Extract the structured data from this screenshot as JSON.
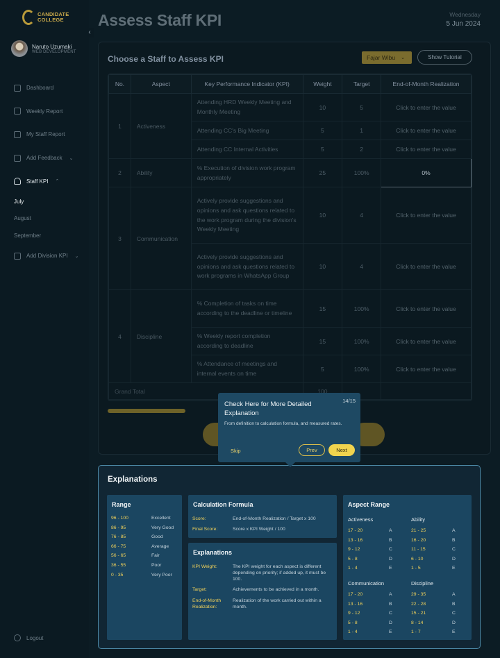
{
  "sidebar": {
    "logo_text_1": "CANDIDATE",
    "logo_text_2": "COLLEGE",
    "user_name": "Naruto Uzumaki",
    "user_role": "WEB DEVELOPMENT",
    "items": [
      {
        "label": "Dashboard"
      },
      {
        "label": "Weekly Report"
      },
      {
        "label": "My Staff Report"
      },
      {
        "label": "Add Feedback"
      },
      {
        "label": "Staff KPI"
      }
    ],
    "sub_items": [
      {
        "label": "July"
      },
      {
        "label": "August"
      },
      {
        "label": "September"
      }
    ],
    "add_division": "Add Division KPI",
    "logout": "Logout"
  },
  "header": {
    "title": "Assess Staff KPI",
    "day": "Wednesday",
    "date": "5 Jun 2024"
  },
  "kpi": {
    "heading": "Choose a  Staff to Assess KPI",
    "staff_selected": "Fajar Wibu",
    "tutorial_label": "Show Tutorial",
    "columns": [
      "No.",
      "Aspect",
      "Key Performance Indicator (KPI)",
      "Weight",
      "Target",
      "End-of-Month Realization"
    ],
    "groups": [
      {
        "no": "1",
        "aspect": "Activeness",
        "rows": [
          {
            "kpi": "Attending HRD Weekly Meeting and Monthly Meeting",
            "weight": "10",
            "target": "5",
            "real": "Click to enter the value"
          },
          {
            "kpi": "Attending CC's Big Meeting",
            "weight": "5",
            "target": "1",
            "real": "Click to enter the value"
          },
          {
            "kpi": "Attending CC Internal Activities",
            "weight": "5",
            "target": "2",
            "real": "Click to enter the value"
          }
        ]
      },
      {
        "no": "2",
        "aspect": "Ability",
        "rows": [
          {
            "kpi": "% Execution of division work program appropriately",
            "weight": "25",
            "target": "100%",
            "real": "0%"
          }
        ]
      },
      {
        "no": "3",
        "aspect": "Communication",
        "rows": [
          {
            "kpi": "Actively provide suggestions and opinions and ask questions related to the work program during the division's Weekly Meeting",
            "weight": "10",
            "target": "4",
            "real": "Click to enter the value"
          },
          {
            "kpi": "Actively provide suggestions and opinions and ask questions related to work programs in WhatsApp Group",
            "weight": "10",
            "target": "4",
            "real": "Click to enter the value"
          }
        ]
      },
      {
        "no": "4",
        "aspect": "Discipline",
        "rows": [
          {
            "kpi": "% Completion of tasks on time according to the deadline or timeline",
            "weight": "15",
            "target": "100%",
            "real": "Click to enter the value"
          },
          {
            "kpi": "% Weekly report completion according to deadline",
            "weight": "15",
            "target": "100%",
            "real": "Click to enter the value"
          },
          {
            "kpi": "% Attendance of meetings and internal events on time",
            "weight": "5",
            "target": "100%",
            "real": "Click to enter the value"
          }
        ]
      }
    ],
    "grand_total_label": "Grand Total",
    "grand_total_value": "100"
  },
  "tooltip": {
    "step": "14/15",
    "title": "Check Here for More Detailed Explanation",
    "desc": "From definition to calculation formula, and measured rates.",
    "skip": "Skip",
    "prev": "Prev",
    "next": "Next"
  },
  "explanations": {
    "title": "Explanations",
    "range": {
      "title": "Range",
      "rows": [
        {
          "r": "96 - 100",
          "g": "Excellent"
        },
        {
          "r": "86 - 95",
          "g": "Very Good"
        },
        {
          "r": "76 - 85",
          "g": "Good"
        },
        {
          "r": "66 - 75",
          "g": "Average"
        },
        {
          "r": "56 - 65",
          "g": "Fair"
        },
        {
          "r": "36 - 55",
          "g": "Poor"
        },
        {
          "r": "0 - 35",
          "g": "Very Poor"
        }
      ]
    },
    "formula": {
      "title": "Calculation Formula",
      "rows": [
        {
          "k": "Score:",
          "v": "End-of-Month Realization / Target x 100"
        },
        {
          "k": "Final Score:",
          "v": "Score x KPI Weight / 100"
        }
      ]
    },
    "defs": {
      "title": "Explanations",
      "rows": [
        {
          "k": "KPI Weight:",
          "v": "The KPI weight for each aspect is different depending on priority; if added up, it must be 100."
        },
        {
          "k": "Target:",
          "v": "Achievements to be achieved in a month."
        },
        {
          "k": "End-of-Month Realization:",
          "v": "Realization of the work carried out within a month."
        }
      ]
    },
    "aspect_range": {
      "title": "Aspect Range",
      "groups": [
        {
          "name": "Activeness",
          "rows": [
            {
              "r": "17 - 20",
              "g": "A"
            },
            {
              "r": "13 - 16",
              "g": "B"
            },
            {
              "r": "9 - 12",
              "g": "C"
            },
            {
              "r": "5 - 8",
              "g": "D"
            },
            {
              "r": "1 - 4",
              "g": "E"
            }
          ]
        },
        {
          "name": "Ability",
          "rows": [
            {
              "r": "21 - 25",
              "g": "A"
            },
            {
              "r": "16 - 20",
              "g": "B"
            },
            {
              "r": "11 - 15",
              "g": "C"
            },
            {
              "r": "6 - 10",
              "g": "D"
            },
            {
              "r": "1 - 5",
              "g": "E"
            }
          ]
        },
        {
          "name": "Communication",
          "rows": [
            {
              "r": "17 - 20",
              "g": "A"
            },
            {
              "r": "13 - 16",
              "g": "B"
            },
            {
              "r": "9 - 12",
              "g": "C"
            },
            {
              "r": "5 - 8",
              "g": "D"
            },
            {
              "r": "1 - 4",
              "g": "E"
            }
          ]
        },
        {
          "name": "Discipline",
          "rows": [
            {
              "r": "29 - 35",
              "g": "A"
            },
            {
              "r": "22 - 28",
              "g": "B"
            },
            {
              "r": "15 - 21",
              "g": "C"
            },
            {
              "r": "8 - 14",
              "g": "D"
            },
            {
              "r": "1 - 7",
              "g": "E"
            }
          ]
        }
      ]
    }
  }
}
